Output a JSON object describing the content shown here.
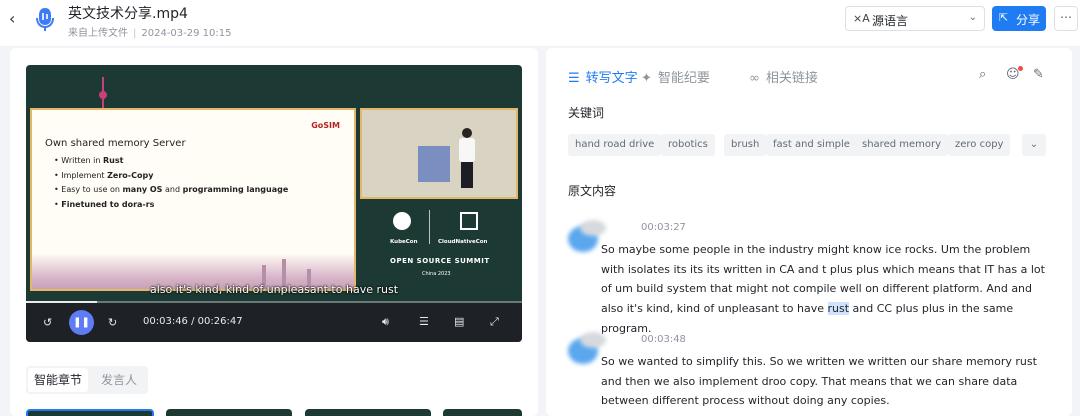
{
  "header": {
    "back_icon": "chevron-left-icon",
    "app_icon": "microphone-icon",
    "title": "英文技术分享.mp4",
    "source": "来自上传文件",
    "separator": "|",
    "datetime": "2024-03-29 10:15",
    "language_select": {
      "icon": "translate-icon",
      "value": "源语言"
    },
    "share_label": "分享",
    "accent_color": "#1f7cf3"
  },
  "video": {
    "slide": {
      "brand": "GoSIM",
      "title": "Own shared memory Server",
      "bullets": [
        {
          "pre": "Written in ",
          "bold": "Rust",
          "post": ""
        },
        {
          "pre": "Implement ",
          "bold": "Zero-Copy",
          "post": ""
        },
        {
          "pre": "Easy to use on ",
          "bold": "many OS",
          "mid": " and ",
          "bold2": "programming language"
        },
        {
          "pre": "",
          "bold": "Finetuned to dora-rs",
          "post": ""
        }
      ]
    },
    "event": {
      "kubecon": "KubeCon",
      "cncf": "CloudNativeCon",
      "summit": "OPEN SOURCE SUMMIT",
      "region": "China 2023"
    },
    "subtitle": "also it's kind, kind of unpleasant to have rust",
    "progress": 0.143,
    "time_current": "00:03:46",
    "time_separator": "/",
    "time_total": "00:26:47",
    "controls": {
      "rewind_icon": "rewind-15-icon",
      "play_icon": "pause-icon",
      "forward_icon": "forward-15-icon",
      "volume_icon": "volume-icon",
      "settings_icon": "sliders-icon",
      "caption_icon": "caption-icon",
      "fullscreen_icon": "fullscreen-icon"
    }
  },
  "left_tabs": {
    "chapters": "智能章节",
    "speakers": "发言人"
  },
  "right_tabs": {
    "transcript": "转写文字",
    "notes": "智能纪要",
    "links": "相关链接"
  },
  "keywords": {
    "label": "关键词",
    "items": [
      "hand road drive",
      "robotics",
      "brush",
      "fast and simple",
      "shared memory",
      "zero copy"
    ]
  },
  "original": {
    "label": "原文内容",
    "paragraphs": [
      {
        "time": "00:03:27",
        "before": "So maybe some people in the industry might know ice rocks. Um the problem with isolates its its its written in CA and t plus plus which means that IT has a lot of um build system that might not compile well on different platform. And and also it's kind, kind of unpleasant to have ",
        "highlight": "rust",
        "after": " and CC plus plus in the same program."
      },
      {
        "time": "00:03:48",
        "before": "So we wanted to simplify this. So we written we written our share memory rust and then we also implement droo copy. That means that we can share data between different process without doing any copies.",
        "highlight": "",
        "after": ""
      }
    ]
  }
}
